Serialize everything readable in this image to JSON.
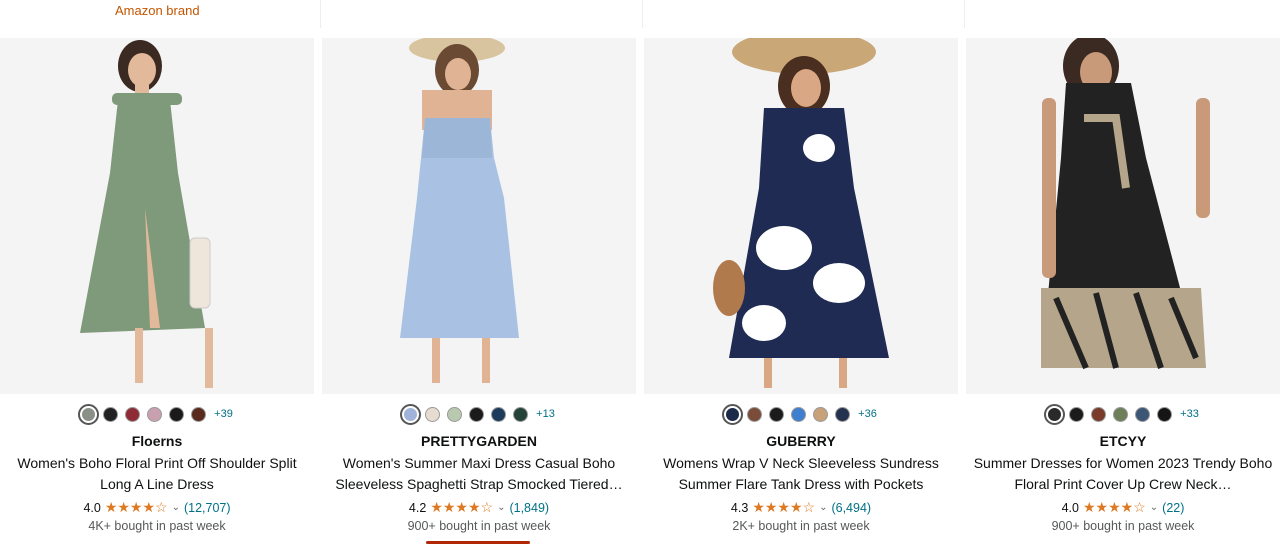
{
  "top_row": {
    "amazon_brand": "Amazon brand"
  },
  "products": [
    {
      "brand": "Floerns",
      "title": "Women's Boho Floral Print Off Shoulder Split Long A Line Dress",
      "rating": "4.0",
      "stars": "★★★★☆",
      "review_count": "(12,707)",
      "bought": "4K+ bought in past week",
      "more_colors": "+39",
      "swatches": [
        "#8a8f88",
        "#222222",
        "#8e2b35",
        "#c9a0b0",
        "#1a1a1a",
        "#5b2a1e"
      ],
      "dress_color": "#7f9a7a"
    },
    {
      "brand": "PRETTYGARDEN",
      "title": "Women's Summer Maxi Dress Casual Boho Sleeveless Spaghetti Strap Smocked Tiered…",
      "rating": "4.2",
      "stars": "★★★★☆",
      "review_count": "(1,849)",
      "bought": "900+ bought in past week",
      "more_colors": "+13",
      "swatches": [
        "#9fb4d8",
        "#e6ddd0",
        "#b8c9b0",
        "#1b1b1b",
        "#1d3c5c",
        "#24443a"
      ],
      "dress_color": "#a9c2e3"
    },
    {
      "brand": "GUBERRY",
      "title": "Womens Wrap V Neck Sleeveless Sundress Summer Flare Tank Dress with Pockets",
      "rating": "4.3",
      "stars": "★★★★☆",
      "review_count": "(6,494)",
      "bought": "2K+ bought in past week",
      "more_colors": "+36",
      "swatches": [
        "#1c2a4a",
        "#7a4d3a",
        "#1b1b1b",
        "#3f7fcf",
        "#c8a07a",
        "#25324f"
      ],
      "dress_color": "#1f2b52"
    },
    {
      "brand": "ETCYY",
      "title": "Summer Dresses for Women 2023 Trendy Boho Floral Print Cover Up Crew Neck…",
      "rating": "4.0",
      "stars": "★★★★☆",
      "review_count": "(22)",
      "bought": "900+ bought in past week",
      "more_colors": "+33",
      "swatches": [
        "#2a2a2a",
        "#1b1b1b",
        "#7a3b2a",
        "#6f7f5a",
        "#3d5676",
        "#151515"
      ],
      "dress_color": "#222222"
    }
  ]
}
